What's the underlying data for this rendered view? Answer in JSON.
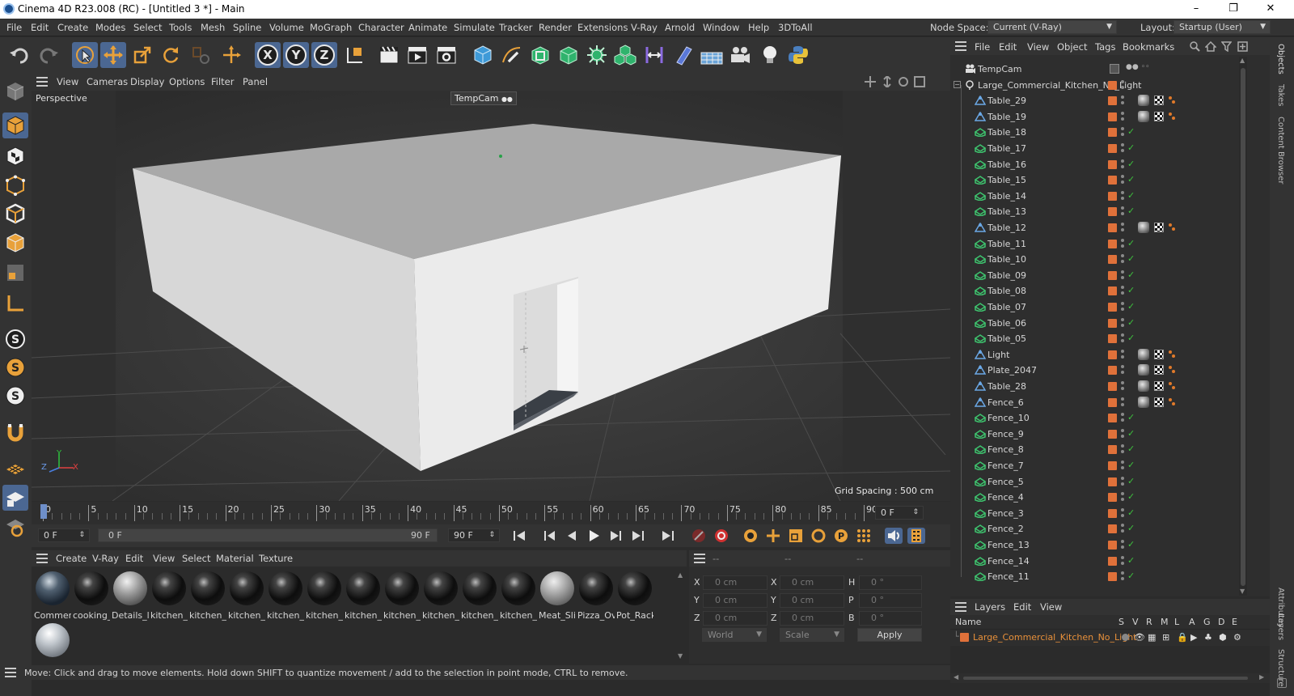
{
  "window": {
    "title": "Cinema 4D R23.008 (RC) - [Untitled 3 *] - Main",
    "minimize": "–",
    "maximize": "❐",
    "close": "✕"
  },
  "menu": [
    "File",
    "Edit",
    "Create",
    "Modes",
    "Select",
    "Tools",
    "Mesh",
    "Spline",
    "Volume",
    "MoGraph",
    "Character",
    "Animate",
    "Simulate",
    "Tracker",
    "Render",
    "Extensions",
    "V-Ray",
    "Arnold",
    "Window",
    "Help",
    "3DToAll"
  ],
  "node_space": {
    "label": "Node Space:",
    "value": "Current (V-Ray)"
  },
  "layout": {
    "label": "Layout:",
    "value": "Startup (User)"
  },
  "viewport": {
    "menu": [
      "View",
      "Cameras",
      "Display",
      "Options",
      "Filter",
      "Panel"
    ],
    "name": "Perspective",
    "camera": "TempCam",
    "grid_spacing": "Grid Spacing : 500 cm",
    "axis": {
      "y": "Y",
      "z": "Z",
      "x": "X"
    }
  },
  "timeline": {
    "ticks": [
      "0",
      "5",
      "10",
      "15",
      "20",
      "25",
      "30",
      "35",
      "40",
      "45",
      "50",
      "55",
      "60",
      "65",
      "70",
      "75",
      "80",
      "85",
      "90"
    ],
    "current_frame": "0 F",
    "start": "0 F",
    "range_start": "0 F",
    "range_end": "90 F",
    "end": "90 F"
  },
  "materials": {
    "menu": [
      "Create",
      "V-Ray",
      "Edit",
      "View",
      "Select",
      "Material",
      "Texture"
    ],
    "items": [
      "Commer",
      "cooking_",
      "Details_l",
      "kitchen_",
      "kitchen_",
      "kitchen_",
      "kitchen_",
      "kitchen_",
      "kitchen_",
      "kitchen_",
      "kitchen_",
      "kitchen_",
      "kitchen_",
      "Meat_Sli",
      "Pizza_Ov",
      "Pot_Rack",
      ""
    ]
  },
  "coords": {
    "headers": [
      "--",
      "--",
      "--"
    ],
    "rows": [
      {
        "a": "X",
        "av": "0 cm",
        "b": "X",
        "bv": "0 cm",
        "c": "H",
        "cv": "0 °"
      },
      {
        "a": "Y",
        "av": "0 cm",
        "b": "Y",
        "bv": "0 cm",
        "c": "P",
        "cv": "0 °"
      },
      {
        "a": "Z",
        "av": "0 cm",
        "b": "Z",
        "bv": "0 cm",
        "c": "B",
        "cv": "0 °"
      }
    ],
    "mode1": "World",
    "mode2": "Scale",
    "apply": "Apply"
  },
  "status": "Move: Click and drag to move elements. Hold down SHIFT to quantize movement / add to the selection in point mode, CTRL to remove.",
  "objects": {
    "menu": [
      "File",
      "Edit",
      "View",
      "Object",
      "Tags",
      "Bookmarks"
    ],
    "items": [
      {
        "name": "TempCam",
        "type": "camera",
        "indent": 0
      },
      {
        "name": "Large_Commercial_Kitchen_No_Light",
        "type": "null",
        "indent": 0
      },
      {
        "name": "Table_29",
        "type": "bone",
        "indent": 1,
        "tags": true
      },
      {
        "name": "Table_19",
        "type": "bone",
        "indent": 1,
        "tags": true
      },
      {
        "name": "Table_18",
        "type": "poly",
        "indent": 1
      },
      {
        "name": "Table_17",
        "type": "poly",
        "indent": 1
      },
      {
        "name": "Table_16",
        "type": "poly",
        "indent": 1
      },
      {
        "name": "Table_15",
        "type": "poly",
        "indent": 1
      },
      {
        "name": "Table_14",
        "type": "poly",
        "indent": 1
      },
      {
        "name": "Table_13",
        "type": "poly",
        "indent": 1
      },
      {
        "name": "Table_12",
        "type": "bone",
        "indent": 1,
        "tags": true
      },
      {
        "name": "Table_11",
        "type": "poly",
        "indent": 1
      },
      {
        "name": "Table_10",
        "type": "poly",
        "indent": 1
      },
      {
        "name": "Table_09",
        "type": "poly",
        "indent": 1
      },
      {
        "name": "Table_08",
        "type": "poly",
        "indent": 1
      },
      {
        "name": "Table_07",
        "type": "poly",
        "indent": 1
      },
      {
        "name": "Table_06",
        "type": "poly",
        "indent": 1
      },
      {
        "name": "Table_05",
        "type": "poly",
        "indent": 1
      },
      {
        "name": "Light",
        "type": "bone",
        "indent": 1,
        "tags": true
      },
      {
        "name": "Plate_2047",
        "type": "bone",
        "indent": 1,
        "tags": true
      },
      {
        "name": "Table_28",
        "type": "bone",
        "indent": 1,
        "tags": true
      },
      {
        "name": "Fence_6",
        "type": "bone",
        "indent": 1,
        "tags": true
      },
      {
        "name": "Fence_10",
        "type": "poly",
        "indent": 1
      },
      {
        "name": "Fence_9",
        "type": "poly",
        "indent": 1
      },
      {
        "name": "Fence_8",
        "type": "poly",
        "indent": 1
      },
      {
        "name": "Fence_7",
        "type": "poly",
        "indent": 1
      },
      {
        "name": "Fence_5",
        "type": "poly",
        "indent": 1
      },
      {
        "name": "Fence_4",
        "type": "poly",
        "indent": 1
      },
      {
        "name": "Fence_3",
        "type": "poly",
        "indent": 1
      },
      {
        "name": "Fence_2",
        "type": "poly",
        "indent": 1
      },
      {
        "name": "Fence_13",
        "type": "poly",
        "indent": 1
      },
      {
        "name": "Fence_14",
        "type": "poly",
        "indent": 1
      },
      {
        "name": "Fence_11",
        "type": "poly",
        "indent": 1
      }
    ]
  },
  "layers": {
    "menu": [
      "Layers",
      "Edit",
      "View"
    ],
    "columns": [
      "Name",
      "S",
      "V",
      "R",
      "M",
      "L",
      "A",
      "G",
      "D",
      "E"
    ],
    "row": "Large_Commercial_Kitchen_No_Light"
  },
  "right_tabs": [
    "Objects",
    "Takes",
    "Content Browser",
    "Attributes",
    "Layers",
    "Structure"
  ],
  "colors": {
    "accent": "#4b6792",
    "layer": "#e0713a",
    "check": "#3ec43e"
  }
}
